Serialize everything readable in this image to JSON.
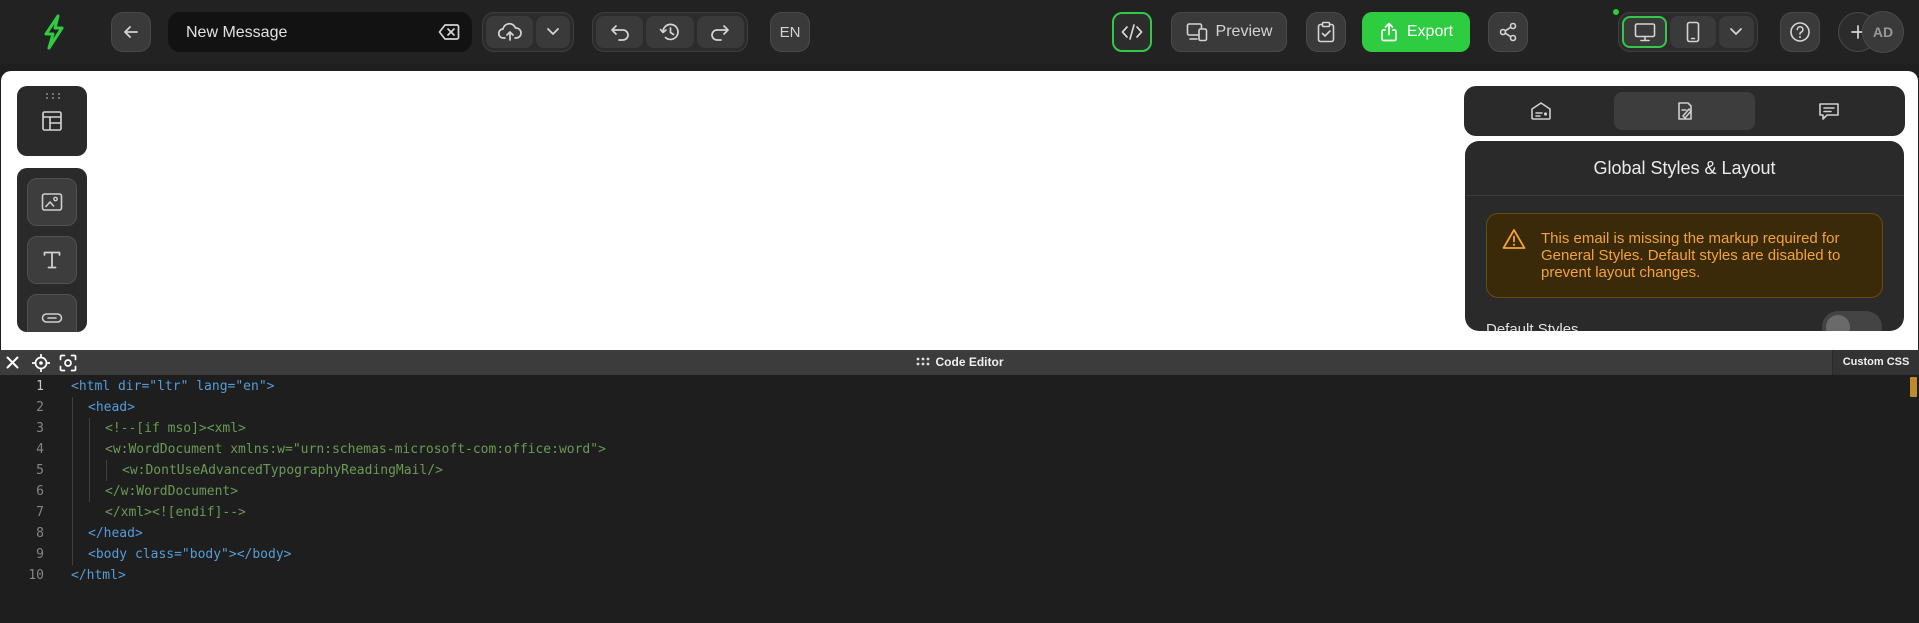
{
  "toolbar": {
    "title_value": "New Message",
    "language": "EN",
    "preview_label": "Preview",
    "export_label": "Export",
    "avatar_initials": "AD",
    "accent_color": "#2ecc40"
  },
  "panel": {
    "title": "Global Styles & Layout",
    "warning": "This email is missing the markup required for General Styles. Default styles are disabled to prevent layout changes.",
    "default_styles_label": "Default Styles",
    "default_styles_enabled": false
  },
  "editor": {
    "title": "Code Editor",
    "custom_css_label": "Custom CSS",
    "line_numbers": [
      "1",
      "2",
      "3",
      "4",
      "5",
      "6",
      "7",
      "8",
      "9",
      "10"
    ],
    "lines": [
      "<html dir=\"ltr\" lang=\"en\">",
      "<head>",
      "<!--[if mso]><xml>",
      "<w:WordDocument xmlns:w=\"urn:schemas-microsoft-com:office:word\">",
      "<w:DontUseAdvancedTypographyReadingMail/>",
      "</w:WordDocument>",
      "</xml><![endif]-->",
      "</head>",
      "<body class=\"body\"></body>",
      "</html>"
    ]
  },
  "icons": [
    "bolt-logo-icon",
    "back-arrow-icon",
    "clear-icon",
    "cloud-upload-icon",
    "chevron-down-icon",
    "undo-icon",
    "history-icon",
    "redo-icon",
    "code-icon",
    "devices-icon",
    "clipboard-check-icon",
    "upload-icon",
    "share-icon",
    "desktop-icon",
    "mobile-icon",
    "help-icon",
    "plus-icon",
    "layout-icon",
    "image-icon",
    "text-icon",
    "button-icon",
    "template-icon",
    "style-icon",
    "comment-icon",
    "warning-icon",
    "close-icon",
    "crosshair-icon",
    "focus-icon",
    "grip-icon"
  ]
}
